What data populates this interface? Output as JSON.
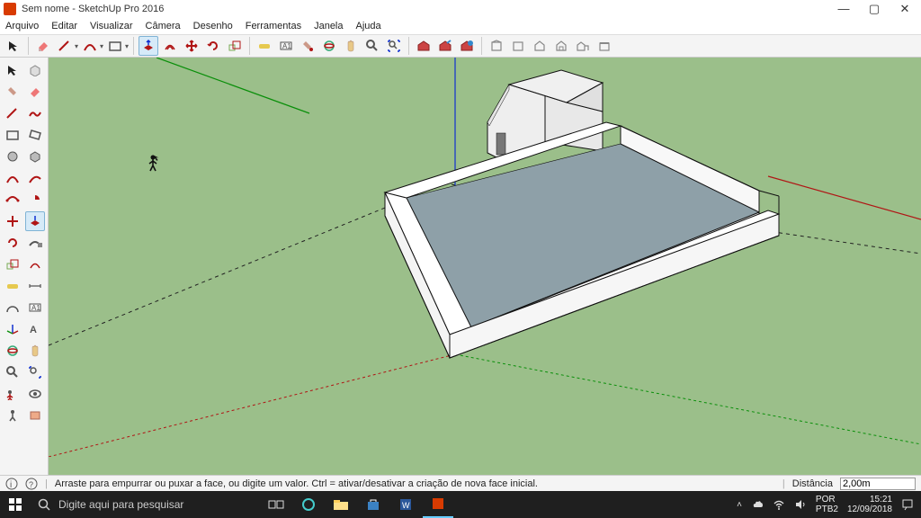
{
  "window": {
    "title": "Sem nome - SketchUp Pro 2016"
  },
  "menu": {
    "items": [
      "Arquivo",
      "Editar",
      "Visualizar",
      "Câmera",
      "Desenho",
      "Ferramentas",
      "Janela",
      "Ajuda"
    ]
  },
  "status": {
    "hint": "Arraste para empurrar ou puxar a face, ou digite um valor. Ctrl = ativar/desativar a criação de nova face inicial.",
    "distance_label": "Distância",
    "distance_value": "2,00m"
  },
  "taskbar": {
    "search_placeholder": "Digite aqui para pesquisar",
    "lang1": "POR",
    "lang2": "PTB2",
    "time": "15:21",
    "date": "12/09/2018"
  },
  "colors": {
    "viewport_ground": "#9bbf8a",
    "axis_green": "#0a8f0a",
    "axis_red": "#b01515",
    "axis_blue": "#1030d0"
  }
}
